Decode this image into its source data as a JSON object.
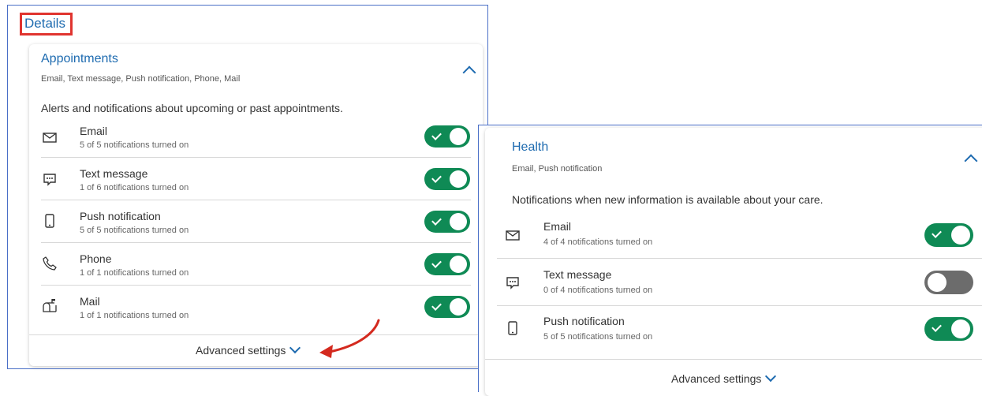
{
  "details": {
    "title": "Details"
  },
  "appointments": {
    "title": "Appointments",
    "subtitle": "Email, Text message, Push notification, Phone, Mail",
    "description": "Alerts and notifications about upcoming or past appointments.",
    "rows": [
      {
        "label": "Email",
        "count": "5 of 5 notifications turned on",
        "icon": "envelope-icon",
        "on": true
      },
      {
        "label": "Text message",
        "count": "1 of 6 notifications turned on",
        "icon": "chat-bubble-icon",
        "on": true
      },
      {
        "label": "Push notification",
        "count": "5 of 5 notifications turned on",
        "icon": "mobile-phone-icon",
        "on": true
      },
      {
        "label": "Phone",
        "count": "1 of 1 notifications turned on",
        "icon": "phone-handset-icon",
        "on": true
      },
      {
        "label": "Mail",
        "count": "1 of 1 notifications turned on",
        "icon": "mailbox-icon",
        "on": true
      }
    ],
    "advanced": "Advanced settings"
  },
  "health": {
    "title": "Health",
    "subtitle": "Email, Push notification",
    "description": "Notifications when new information is available about your care.",
    "rows": [
      {
        "label": "Email",
        "count": "4 of 4 notifications turned on",
        "icon": "envelope-icon",
        "on": true
      },
      {
        "label": "Text message",
        "count": "0 of 4 notifications turned on",
        "icon": "chat-bubble-icon",
        "on": false
      },
      {
        "label": "Push notification",
        "count": "5 of 5 notifications turned on",
        "icon": "mobile-phone-icon",
        "on": true
      }
    ],
    "advanced": "Advanced settings"
  },
  "colors": {
    "accent": "#1e6bb0",
    "toggle_on": "#0f8a55",
    "toggle_off": "#6c6c6c",
    "highlight": "#e0342f",
    "frame": "#4a6fc7"
  }
}
